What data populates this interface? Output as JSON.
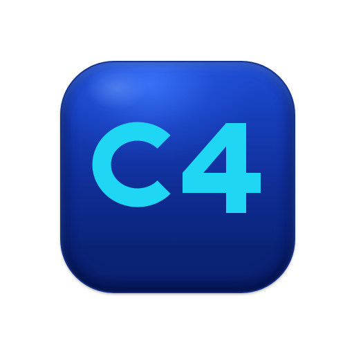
{
  "icon": {
    "label": "C4",
    "letter": "C",
    "digit": "4"
  },
  "colors": {
    "background": "#ffffff",
    "icon_top": "#1f4fd6",
    "icon_bottom": "#0a2378",
    "glyph": "#1fd6f5"
  }
}
